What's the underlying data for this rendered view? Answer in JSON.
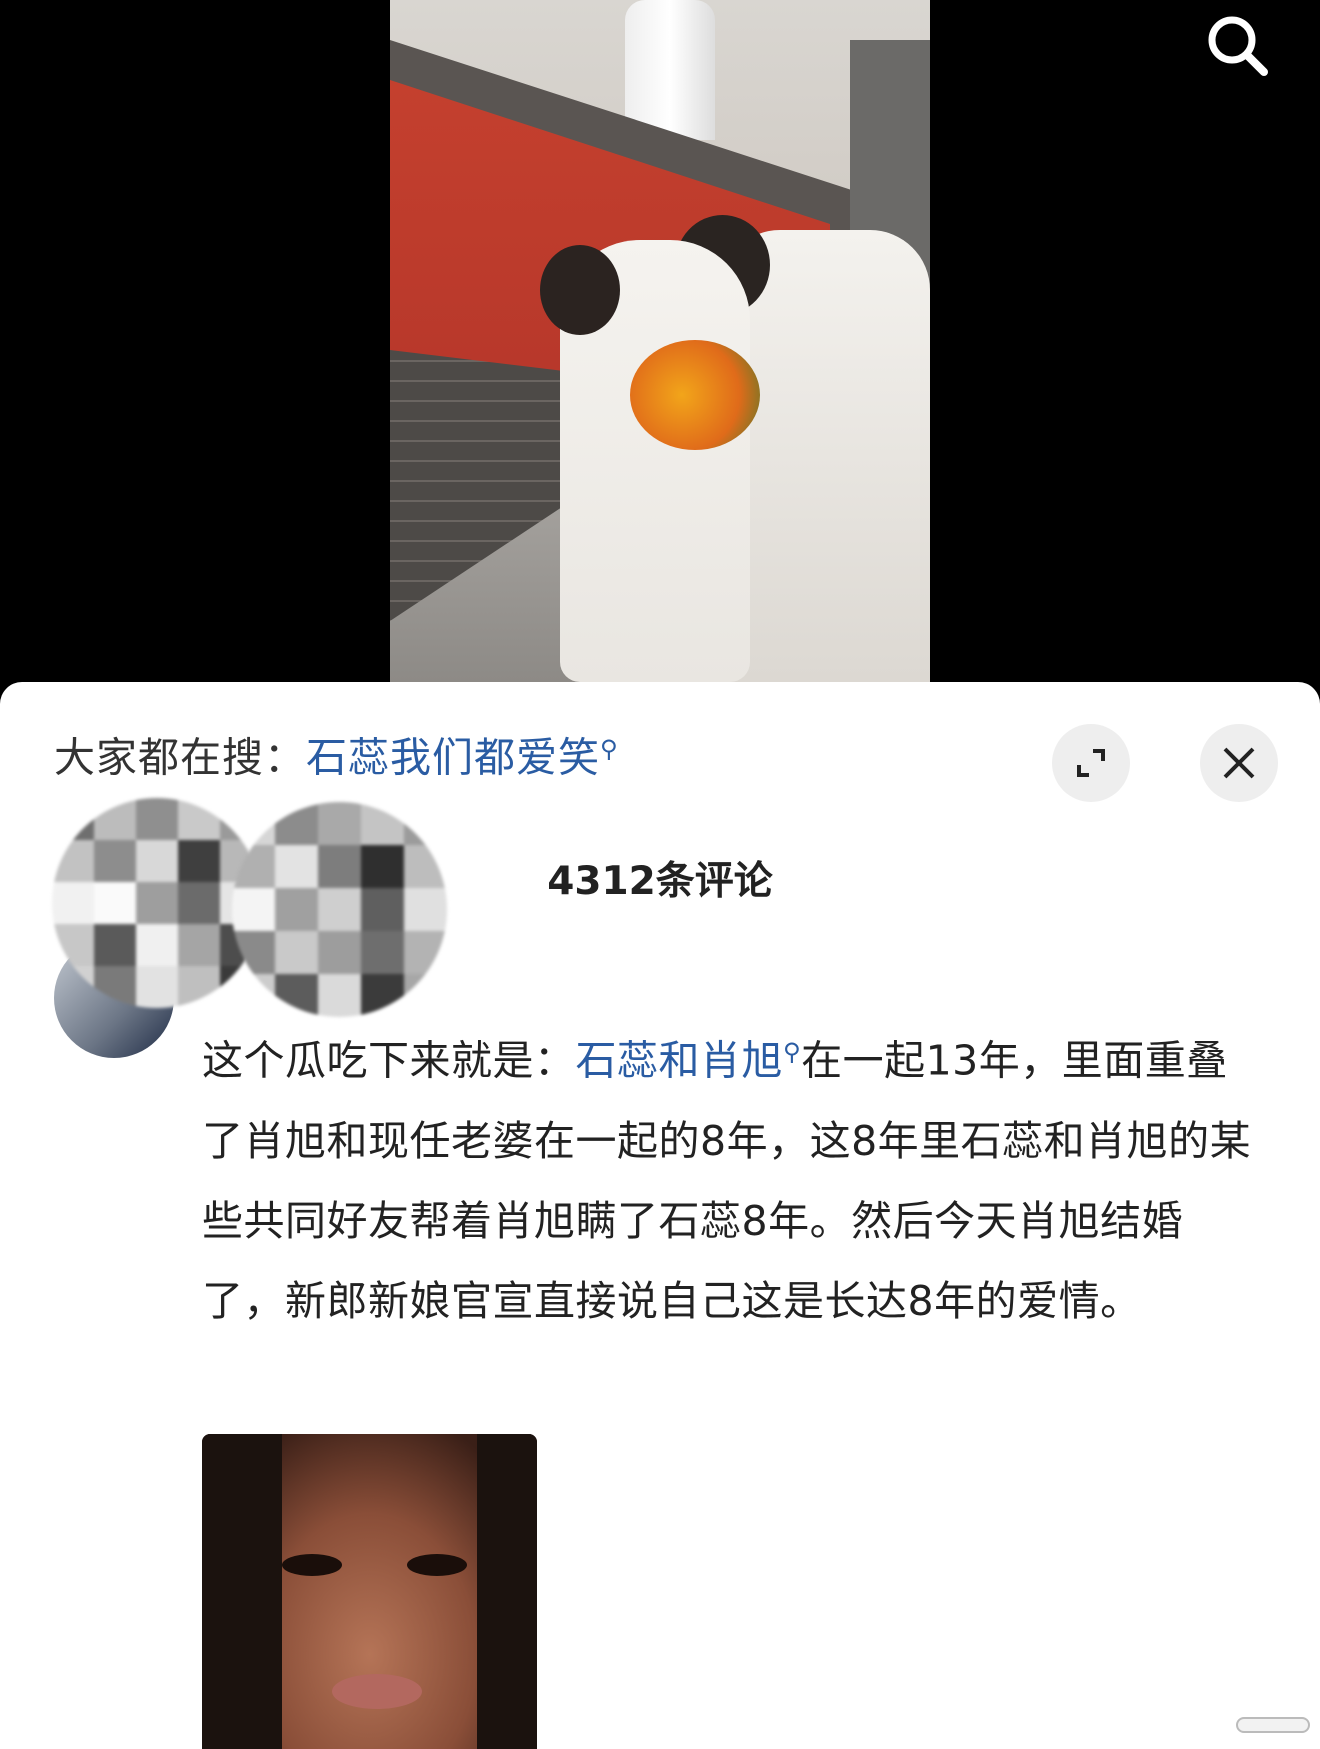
{
  "suggest": {
    "prefix": "大家都在搜：",
    "link": "石蕊我们都爱笑"
  },
  "comments": {
    "count_label": "4312条评论"
  },
  "comment": {
    "part1": "这个瓜吃下来就是：",
    "link": "石蕊和肖旭",
    "part2": "在一起13年，里面重叠了肖旭和现任老婆在一起的8年，这8年里石蕊和肖旭的某些共同好友帮着肖旭瞒了石蕊8年。然后今天肖旭结婚了，新郎新娘官宣直接说自己这是长达8年的爱情。"
  },
  "colors": {
    "link": "#2a5ca3",
    "text": "#222222",
    "sheet_bg": "#ffffff",
    "page_bg": "#000000"
  },
  "icons": {
    "search": "search-icon",
    "expand": "expand-icon",
    "close": "close-icon"
  }
}
